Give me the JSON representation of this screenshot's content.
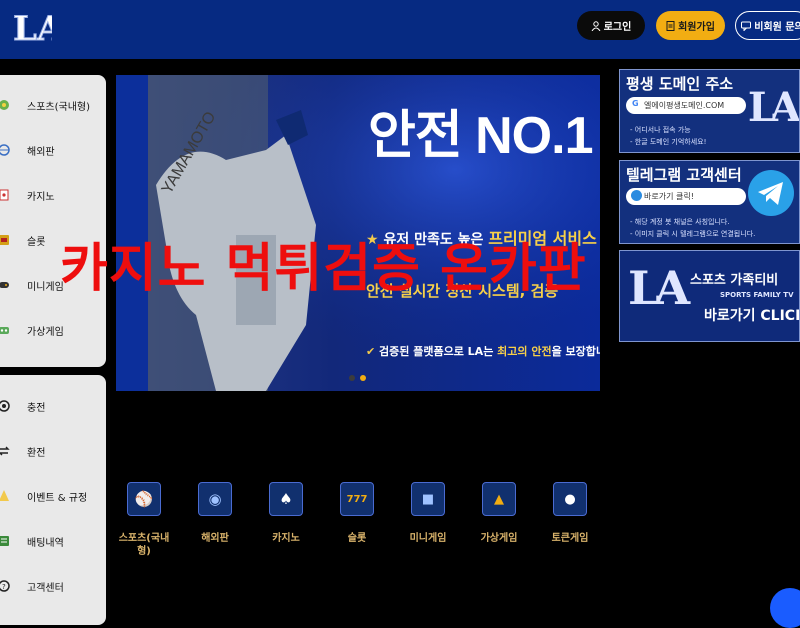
{
  "header": {
    "logo_text": "LA",
    "login_label": "로그인",
    "signup_label": "회원가입",
    "guest_inquiry_label": "비회원 문의"
  },
  "sidebar": {
    "primary": [
      {
        "label": "스포츠(국내형)",
        "icon": "soccer-ball-icon"
      },
      {
        "label": "해외판",
        "icon": "globe-icon"
      },
      {
        "label": "카지노",
        "icon": "cards-icon"
      },
      {
        "label": "슬롯",
        "icon": "slot-machine-icon"
      },
      {
        "label": "미니게임",
        "icon": "gamepad-icon"
      },
      {
        "label": "가상게임",
        "icon": "vr-icon"
      }
    ],
    "secondary": [
      {
        "label": "충전",
        "icon": "deposit-icon"
      },
      {
        "label": "환전",
        "icon": "exchange-icon"
      },
      {
        "label": "이벤트 & 규정",
        "icon": "event-icon"
      },
      {
        "label": "배팅내역",
        "icon": "history-icon"
      },
      {
        "label": "고객센터",
        "icon": "support-icon"
      }
    ]
  },
  "banner": {
    "headline": "안전 NO.1",
    "line1_prefix": "유저 만족도 높은",
    "line1_highlight": "프리미엄 서비스",
    "line2": "안전 실시간 정산 시스템, 검증",
    "line3_prefix": "검증된 플랫폼으로 LA는",
    "line3_highlight": "최고의 안전",
    "line3_suffix": "을 보장합니다",
    "player_name": "YAMAMOTO"
  },
  "ads": {
    "domain": {
      "title": "평생 도메인 주소",
      "pill_text": "엘에이평생도메인.COM",
      "lines": [
        "- 어디서나 접속 가능",
        "- 한글 도메인 기억하세요!"
      ],
      "logo_text": "LA"
    },
    "telegram": {
      "title": "텔레그램 고객센터",
      "pill_text": "바로가기 클릭!",
      "lines": [
        "- 해당 계정 봇 채널은 사칭입니다.",
        "- 이미지 클릭 시 텔레그램으로 연결됩니다."
      ]
    },
    "sports_tv": {
      "title": "스포츠 가족티비",
      "subtitle": "SPORTS FAMILY TV",
      "cta": "바로가기 CLICK",
      "logo_text": "LA"
    }
  },
  "watermark_text": "카지노 먹튀검증 온카판",
  "games": [
    {
      "label": "스포츠(국내형)",
      "icon": "sports-game-icon"
    },
    {
      "label": "해외판",
      "icon": "overseas-game-icon"
    },
    {
      "label": "카지노",
      "icon": "casino-game-icon"
    },
    {
      "label": "슬롯",
      "icon": "slot-game-icon"
    },
    {
      "label": "미니게임",
      "icon": "mini-game-icon"
    },
    {
      "label": "가상게임",
      "icon": "virtual-game-icon"
    },
    {
      "label": "토큰게임",
      "icon": "token-game-icon"
    }
  ],
  "colors": {
    "header_bg": "#062a82",
    "accent_gold": "#f2ad12",
    "watermark_red": "#ee0e0e",
    "game_label": "#d9b36b"
  }
}
